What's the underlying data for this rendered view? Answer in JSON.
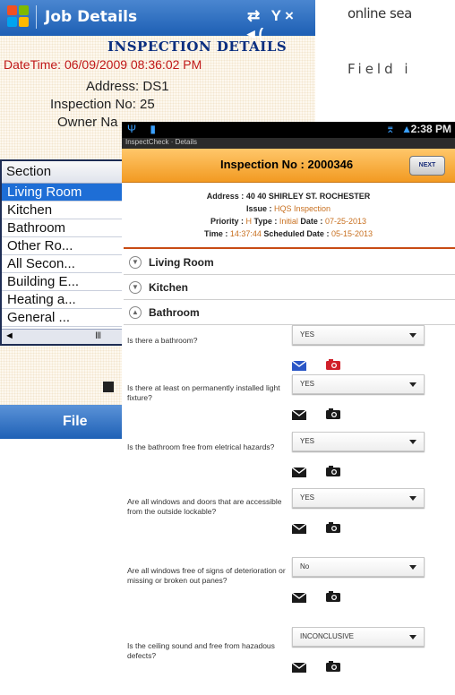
{
  "doc": {
    "line1": "online sea",
    "line2": "Field i"
  },
  "wm": {
    "title": "Job Details",
    "status_icons": "⇄ Y× ◂(",
    "heading": "INSPECTION DETAILS",
    "datetime": "DateTime: 06/09/2009 08:36:02 PM",
    "address": "Address: DS1",
    "inspection": "Inspection No: 25",
    "owner": "Owner Na",
    "list_header": "Section",
    "sections": [
      "Living Room",
      "Kitchen",
      "Bathroom",
      "Other Ro...",
      "All Secon...",
      "Building E...",
      "Heating a...",
      "General ..."
    ],
    "selected_index": 0,
    "scroll_left": "◄",
    "scroll_thumb": "III",
    "softkey_left": "File"
  },
  "android": {
    "status_time": "2:38 PM",
    "status_left": "Ψ ▮",
    "status_right": "⌆ ▲",
    "crumb": "InspectCheck · Details",
    "inspection_title": "Inspection No : 2000346",
    "next_label": "NEXT",
    "info": {
      "address_label": "Address :",
      "address_value": "40 40 SHIRLEY ST.  ROCHESTER",
      "issue_label": "Issue :",
      "issue_value": "HQS Inspection",
      "priority_label": "Priority :",
      "priority_value": "H",
      "type_label": "Type :",
      "type_value": "Initial",
      "date_label": "Date :",
      "date_value": "07-25-2013",
      "time_label": "Time :",
      "time_value": "14:37:44",
      "sched_label": "Scheduled Date :",
      "sched_value": "05-15-2013"
    },
    "sections": [
      {
        "name": "Living Room",
        "expanded": false
      },
      {
        "name": "Kitchen",
        "expanded": false
      },
      {
        "name": "Bathroom",
        "expanded": true
      }
    ],
    "questions": [
      {
        "text": "Is there a bathroom?",
        "answer": "YES",
        "icons_color": "colored"
      },
      {
        "text": "Is there at least on permanently installed light fixture?",
        "answer": "YES",
        "icons_color": "dark"
      },
      {
        "text": "Is the bathroom free from eletrical hazards?",
        "answer": "YES",
        "icons_color": "dark"
      },
      {
        "text": "Are all windows and doors that are accessible from the outside lockable?",
        "answer": "YES",
        "icons_color": "dark"
      },
      {
        "text": "Are all windows free of signs of deterioration or missing or broken out panes?",
        "answer": "No",
        "icons_color": "dark"
      },
      {
        "text": "Is the ceiling sound and free from hazadous defects?",
        "answer": "INCONCLUSIVE",
        "icons_color": "dark"
      }
    ]
  },
  "colors": {
    "wm_bar": "#1d5fb4",
    "wm_selected": "#1e6ed6",
    "wm_heading": "#0b2f80",
    "wm_datetime": "#c01818",
    "android_header": "#f29a22",
    "android_divider": "#c84b14",
    "mail_blue": "#2a56c6",
    "camera_red": "#d0202a"
  }
}
